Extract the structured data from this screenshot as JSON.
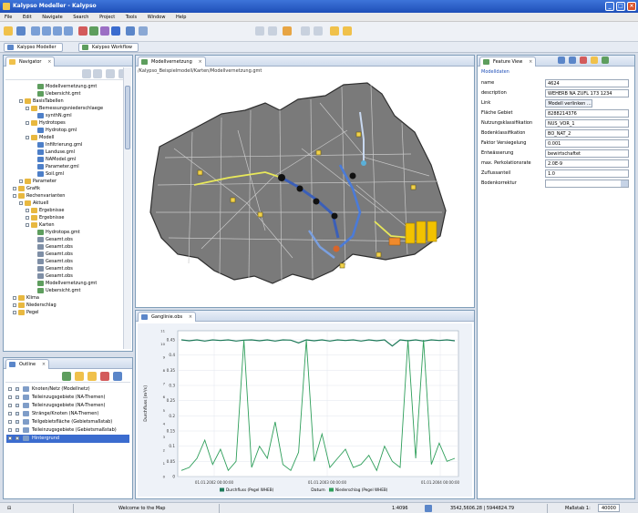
{
  "window": {
    "title": "Kalypso Modeller - Kalypso",
    "controls": [
      "_",
      "□",
      "×"
    ]
  },
  "menu": [
    "File",
    "Edit",
    "Navigate",
    "Search",
    "Project",
    "Tools",
    "Window",
    "Help"
  ],
  "perspectives": [
    "Kalypso Modeller",
    "Kalypso Workflow"
  ],
  "navigator": {
    "tab": "Navigator",
    "items": [
      {
        "label": "Modellvernetzung.gmt",
        "icon": "map-file-icon",
        "depth": 5
      },
      {
        "label": "Uebersicht.gmt",
        "icon": "map-file-icon",
        "depth": 5
      },
      {
        "label": "BasisTabellen",
        "icon": "folder-icon",
        "depth": 3
      },
      {
        "label": "Bemessungsniederschlaege",
        "icon": "folder-icon",
        "depth": 4
      },
      {
        "label": "synthN.gml",
        "icon": "gml-file-icon",
        "depth": 5
      },
      {
        "label": "Hydrotopes",
        "icon": "folder-icon",
        "depth": 4
      },
      {
        "label": "Hydrotop.gml",
        "icon": "gml-file-icon",
        "depth": 5
      },
      {
        "label": "Modell",
        "icon": "folder-icon",
        "depth": 4
      },
      {
        "label": "Infiltrierung.gml",
        "icon": "gml-file-icon",
        "depth": 5
      },
      {
        "label": "Landuse.gml",
        "icon": "gml-file-icon",
        "depth": 5
      },
      {
        "label": "NAModel.gml",
        "icon": "gml-file-icon",
        "depth": 5
      },
      {
        "label": "Parameter.gml",
        "icon": "gml-file-icon",
        "depth": 5
      },
      {
        "label": "Soil.gml",
        "icon": "gml-file-icon",
        "depth": 5
      },
      {
        "label": "Parameter",
        "icon": "folder-icon",
        "depth": 3
      },
      {
        "label": "Grafik",
        "icon": "folder-icon",
        "depth": 2
      },
      {
        "label": "Rechenvarianten",
        "icon": "folder-icon",
        "depth": 2
      },
      {
        "label": "Aktuell",
        "icon": "folder-icon",
        "depth": 3
      },
      {
        "label": "Ergebnisse",
        "icon": "folder-icon",
        "depth": 4
      },
      {
        "label": "Ergebnisse",
        "icon": "folder-icon",
        "depth": 4
      },
      {
        "label": "Karten",
        "icon": "folder-icon",
        "depth": 4
      },
      {
        "label": "Hydrotope.gmt",
        "icon": "map-file-icon",
        "depth": 5
      },
      {
        "label": "Gesamt.obs",
        "icon": "obs-file-icon",
        "depth": 5
      },
      {
        "label": "Gesamt.obs",
        "icon": "obs-file-icon",
        "depth": 5
      },
      {
        "label": "Gesamt.obs",
        "icon": "obs-file-icon",
        "depth": 5
      },
      {
        "label": "Gesamt.obs",
        "icon": "obs-file-icon",
        "depth": 5
      },
      {
        "label": "Gesamt.obs",
        "icon": "obs-file-icon",
        "depth": 5
      },
      {
        "label": "Gesamt.obs",
        "icon": "obs-file-icon",
        "depth": 5
      },
      {
        "label": "Modellvernetzung.gmt",
        "icon": "map-file-icon",
        "depth": 5
      },
      {
        "label": "Uebersicht.gmt",
        "icon": "map-file-icon",
        "depth": 5
      },
      {
        "label": "Klima",
        "icon": "folder-icon",
        "depth": 2
      },
      {
        "label": "Niederschlag",
        "icon": "folder-icon",
        "depth": 2
      },
      {
        "label": "Pegel",
        "icon": "folder-icon",
        "depth": 2
      }
    ]
  },
  "outline": {
    "tab": "Outline",
    "items": [
      {
        "label": "Knoten/Netz (Modellnetz)",
        "checked": true,
        "selected": false
      },
      {
        "label": "Teileinzugsgebiete (NA-Themen)",
        "checked": true,
        "selected": false
      },
      {
        "label": "Teileinzugsgebiete (NA-Themen)",
        "checked": true,
        "selected": false
      },
      {
        "label": "Stränge/Knoten (NA-Themen)",
        "checked": true,
        "selected": false
      },
      {
        "label": "Teilgebietsfläche (Gebietsmaßstab)",
        "checked": true,
        "selected": false
      },
      {
        "label": "Teileinzugsgebiete (Gebietsmaßstab)",
        "checked": true,
        "selected": false
      },
      {
        "label": "Hintergrund",
        "checked": true,
        "selected": true
      }
    ]
  },
  "map_editor": {
    "tab": "Modellvernetzung",
    "path": "/Kalypso_Beispielmodell/Karten/Modellvernetzung.gmt"
  },
  "properties": {
    "tab": "Feature View",
    "section": "Modelldaten",
    "rows": [
      {
        "label": "name",
        "value": "4624"
      },
      {
        "label": "description",
        "value": "WEHERB NA ZUFL 173 1234"
      },
      {
        "label": "Link",
        "value": "Modell verlinken ..."
      },
      {
        "label": "Fläche Gebiet",
        "value": "8288214376"
      },
      {
        "label": "Nutzungsklassifikation",
        "value": "NUS_VOR_1"
      },
      {
        "label": "Bodenklassifikation",
        "value": "BO_NAT_2"
      },
      {
        "label": "Faktor Versiegelung",
        "value": "0.001"
      },
      {
        "label": "Entwässerung",
        "value": "bewirtschaftet"
      },
      {
        "label": "max. Perkolationsrate",
        "value": "2.0E-9"
      },
      {
        "label": "Zuflussanteil",
        "value": "1.0"
      },
      {
        "label": "Bodenkorrektur",
        "value": ""
      }
    ]
  },
  "timeseries": {
    "tab": "Ganglinie.obs",
    "legend": [
      "Durchfluss (Pegel WHEB)",
      "Niederschlag (Pegel WHEB)"
    ]
  },
  "chart_data": {
    "type": "line",
    "xlabel": "Datum",
    "ylabel": "Durchfluss [m³/s]",
    "x_ticks": [
      "01.01.2002 00:00:00",
      "01.01.2003 00:00:00",
      "01.01.2004 00:00:00"
    ],
    "y_ticks": [
      0.0,
      0.05,
      0.1,
      0.15,
      0.2,
      0.25,
      0.3,
      0.35,
      0.4,
      0.45
    ],
    "ylim": [
      0,
      0.48
    ],
    "y2_ticks": [
      0,
      1,
      2,
      3,
      4,
      5,
      6,
      7,
      8,
      9,
      10,
      11
    ],
    "series": [
      {
        "name": "Durchfluss (Pegel WHEB)",
        "color": "#1f7a5a",
        "values": [
          0.45,
          0.447,
          0.45,
          0.446,
          0.45,
          0.448,
          0.45,
          0.446,
          0.449,
          0.45,
          0.447,
          0.45,
          0.446,
          0.45,
          0.449,
          0.44,
          0.45,
          0.447,
          0.45,
          0.446,
          0.45,
          0.448,
          0.45,
          0.446,
          0.45,
          0.447,
          0.45,
          0.43,
          0.45,
          0.447,
          0.45,
          0.446,
          0.45,
          0.448,
          0.45,
          0.447
        ]
      },
      {
        "name": "Niederschlag (Pegel WHEB)",
        "color": "#2e9e5a",
        "values": [
          0.02,
          0.03,
          0.06,
          0.12,
          0.04,
          0.09,
          0.02,
          0.05,
          0.45,
          0.03,
          0.1,
          0.06,
          0.18,
          0.04,
          0.02,
          0.08,
          0.45,
          0.05,
          0.14,
          0.03,
          0.06,
          0.09,
          0.03,
          0.04,
          0.07,
          0.02,
          0.1,
          0.05,
          0.03,
          0.45,
          0.06,
          0.45,
          0.04,
          0.11,
          0.05,
          0.06
        ]
      }
    ]
  },
  "status": {
    "message": "Welcome to the Map",
    "scale": "1:4096",
    "coords": "3542,5606.28 | 5944824.79",
    "zoom": "Maßstab 1:",
    "zoom_value": "40000"
  },
  "colors": {
    "accent": "#2e9e5a",
    "selection": "#3b6ccf",
    "map_highlight": "#f2c200"
  }
}
